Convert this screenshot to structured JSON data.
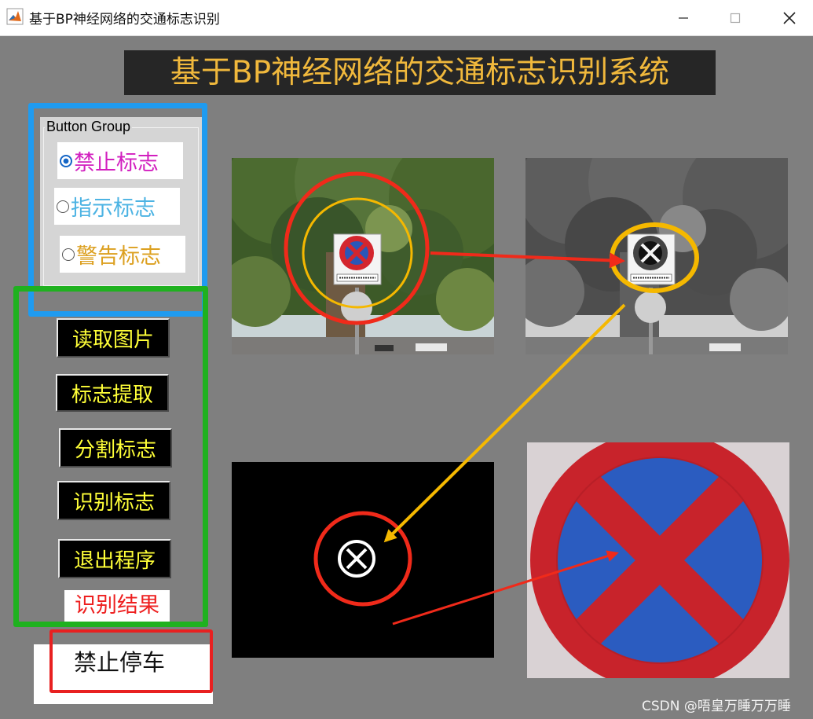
{
  "window": {
    "title": "基于BP神经网络的交通标志识别"
  },
  "banner": {
    "title": "基于BP神经网络的交通标志识别系统"
  },
  "button_group": {
    "title": "Button Group",
    "options": [
      {
        "label": "禁止标志",
        "selected": true,
        "color": "#d21fbf"
      },
      {
        "label": "指示标志",
        "selected": false,
        "color": "#4cb3e3"
      },
      {
        "label": "警告标志",
        "selected": false,
        "color": "#dca020"
      }
    ]
  },
  "actions": {
    "read_image": "读取图片",
    "extract_sign": "标志提取",
    "segment_sign": "分割标志",
    "recognize_sign": "识别标志",
    "exit": "退出程序"
  },
  "result": {
    "label": "识别结果",
    "value": "禁止停车"
  },
  "images": {
    "original": "tree-scene-with-no-parking-sign",
    "gray": "grayscale-tree-scene",
    "binary": "binary-sign-mask",
    "sign": "segmented-no-parking-sign"
  },
  "colors": {
    "window_bg": "#7f7f7f",
    "banner_bg": "#262626",
    "banner_text": "#f0b83c",
    "button_bg": "#000000",
    "button_text": "#ffff38",
    "annotation_blue": "#1f9bf0",
    "annotation_green": "#1fb11f",
    "annotation_red": "#e82020",
    "annotation_orange": "#f5b800"
  },
  "watermark": "CSDN @唔皇万睡万万睡"
}
